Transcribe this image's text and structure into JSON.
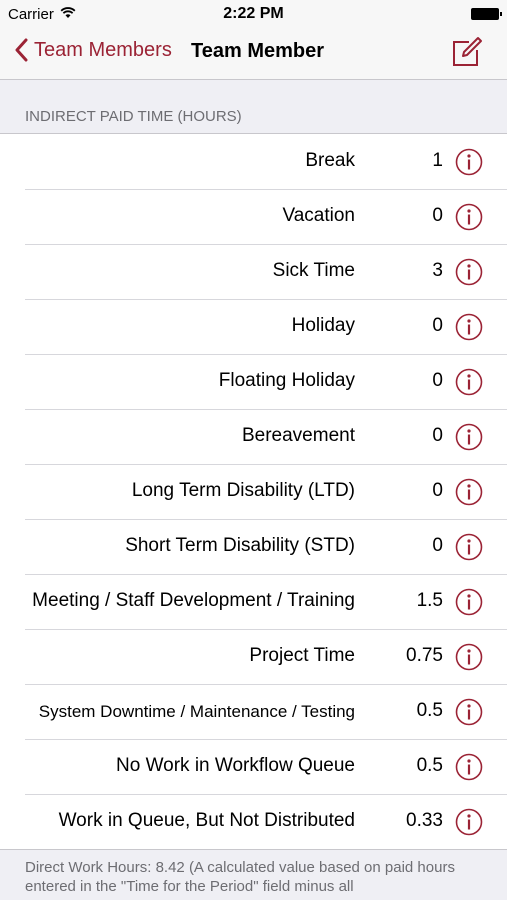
{
  "status_bar": {
    "carrier": "Carrier",
    "time": "2:22 PM",
    "wifi_icon": "wifi-icon",
    "battery_icon": "battery-icon"
  },
  "nav_bar": {
    "back_label": "Team Members",
    "title": "Team Member",
    "back_icon": "chevron-left-icon",
    "edit_icon": "compose-icon",
    "accent_color": "#9b2335"
  },
  "section": {
    "header": "INDIRECT PAID TIME (HOURS)",
    "info_icon": "info-circle-icon",
    "rows": [
      {
        "label": "Break",
        "value": "1"
      },
      {
        "label": "Vacation",
        "value": "0"
      },
      {
        "label": "Sick Time",
        "value": "3"
      },
      {
        "label": "Holiday",
        "value": "0"
      },
      {
        "label": "Floating Holiday",
        "value": "0"
      },
      {
        "label": "Bereavement",
        "value": "0"
      },
      {
        "label": "Long Term Disability (LTD)",
        "value": "0"
      },
      {
        "label": "Short Term Disability (STD)",
        "value": "0"
      },
      {
        "label": "Meeting / Staff Development / Training",
        "value": "1.5"
      },
      {
        "label": "Project Time",
        "value": "0.75"
      },
      {
        "label": "System Downtime / Maintenance / Testing",
        "value": "0.5"
      },
      {
        "label": "No Work in Workflow Queue",
        "value": "0.5"
      },
      {
        "label": "Work in Queue, But Not Distributed",
        "value": "0.33"
      }
    ]
  },
  "footer": {
    "text": "Direct Work Hours: 8.42 (A calculated value based on paid hours entered in the \"Time for the Period\" field minus all"
  }
}
